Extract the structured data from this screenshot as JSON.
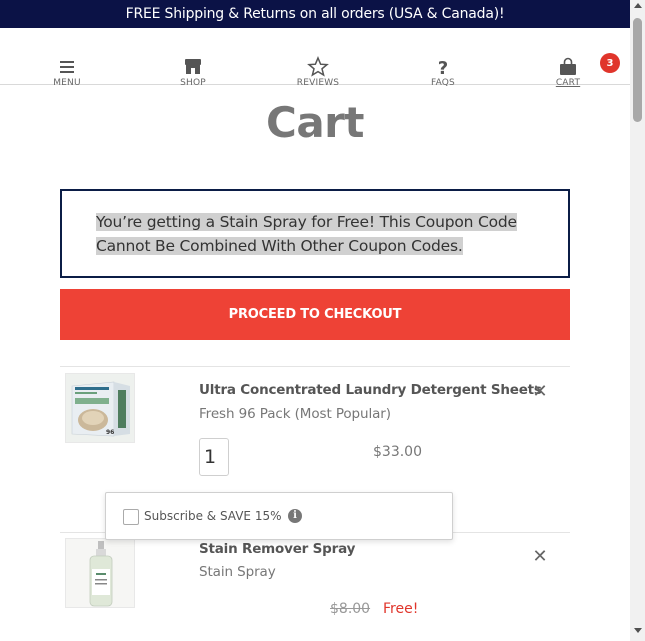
{
  "announcement": "FREE Shipping & Returns on all orders (USA & Canada)!",
  "nav": {
    "menu_label": "MENU",
    "shop_label": "SHOP",
    "reviews_label": "REVIEWS",
    "faqs_label": "FAQS",
    "cart_label": "CART",
    "cart_count": "3"
  },
  "page_title": "Cart",
  "coupon_message": "You’re getting a Stain Spray for Free! This Coupon Code Cannot Be Combined With Other Coupon Codes.",
  "checkout_label": "PROCEED TO CHECKOUT",
  "items": [
    {
      "name": "Ultra Concentrated Laundry Detergent Sheets",
      "variant": "Fresh 96 Pack (Most Popular)",
      "quantity": "1",
      "price": "$33.00",
      "thumb_brand": "CLEAN PEOPLE",
      "thumb_count": "96"
    },
    {
      "name": "Stain Remover Spray",
      "variant": "Stain Spray",
      "original_price": "$8.00",
      "price": "Free!",
      "thumb_brand": "CLEAN PEOPLE"
    }
  ],
  "subscribe": {
    "label": "Subscribe & SAVE 15%",
    "info_glyph": "i"
  },
  "colors": {
    "announcement_bg": "#0b1246",
    "checkout_bg": "#ee4236",
    "badge_bg": "#e0352b",
    "coupon_border": "#0b1d46"
  }
}
